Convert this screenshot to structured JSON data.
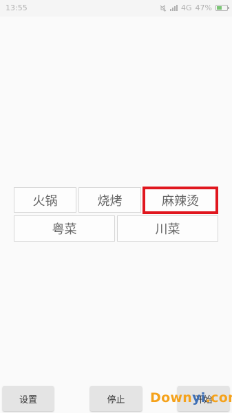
{
  "status_bar": {
    "time": "13:55",
    "network": "4G",
    "battery_percent": "47%",
    "battery_level": 0.47,
    "icons": [
      "mute-icon",
      "signal-icon",
      "battery-charging-icon"
    ]
  },
  "food_options": {
    "row1": [
      "火锅",
      "烧烤",
      "麻辣烫"
    ],
    "row2": [
      "粤菜",
      "川菜"
    ],
    "selected": "麻辣烫",
    "selected_color": "#e0161e"
  },
  "bottom_bar": {
    "settings_label": "设置",
    "stop_label": "停止",
    "start_label": "开始"
  },
  "watermark": {
    "part_a": "Down",
    "part_b": "yi",
    "part_c": ".com"
  }
}
